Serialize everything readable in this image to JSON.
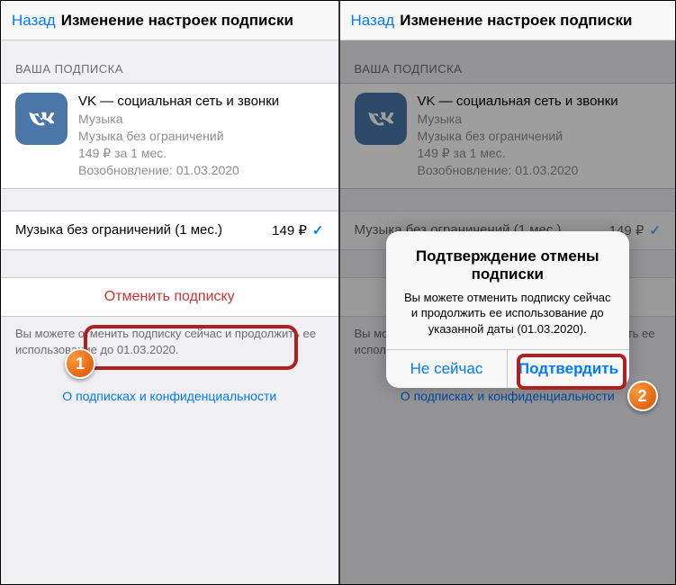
{
  "nav": {
    "back": "Назад",
    "title": "Изменение настроек подписки"
  },
  "section_header": "ВАША ПОДПИСКА",
  "app": {
    "name": "VK — социальная сеть и звонки",
    "category": "Музыка",
    "plan": "Музыка без ограничений",
    "price_line": "149 ₽ за 1 мес.",
    "renewal": "Возобновление: 01.03.2020"
  },
  "option": {
    "label": "Музыка без ограничений (1 мес.)",
    "price": "149 ₽"
  },
  "cancel_button": "Отменить подписку",
  "footnote": "Вы можете отменить подписку сейчас и продолжить ее использование до 01.03.2020.",
  "privacy_link": "О подписках и конфиденциальности",
  "alert": {
    "title": "Подтверждение отмены подписки",
    "message": "Вы можете отменить подписку сейчас и продолжить ее использование до указанной даты (01.03.2020).",
    "cancel": "Не сейчас",
    "confirm": "Подтвердить"
  },
  "step_badges": {
    "one": "1",
    "two": "2"
  }
}
